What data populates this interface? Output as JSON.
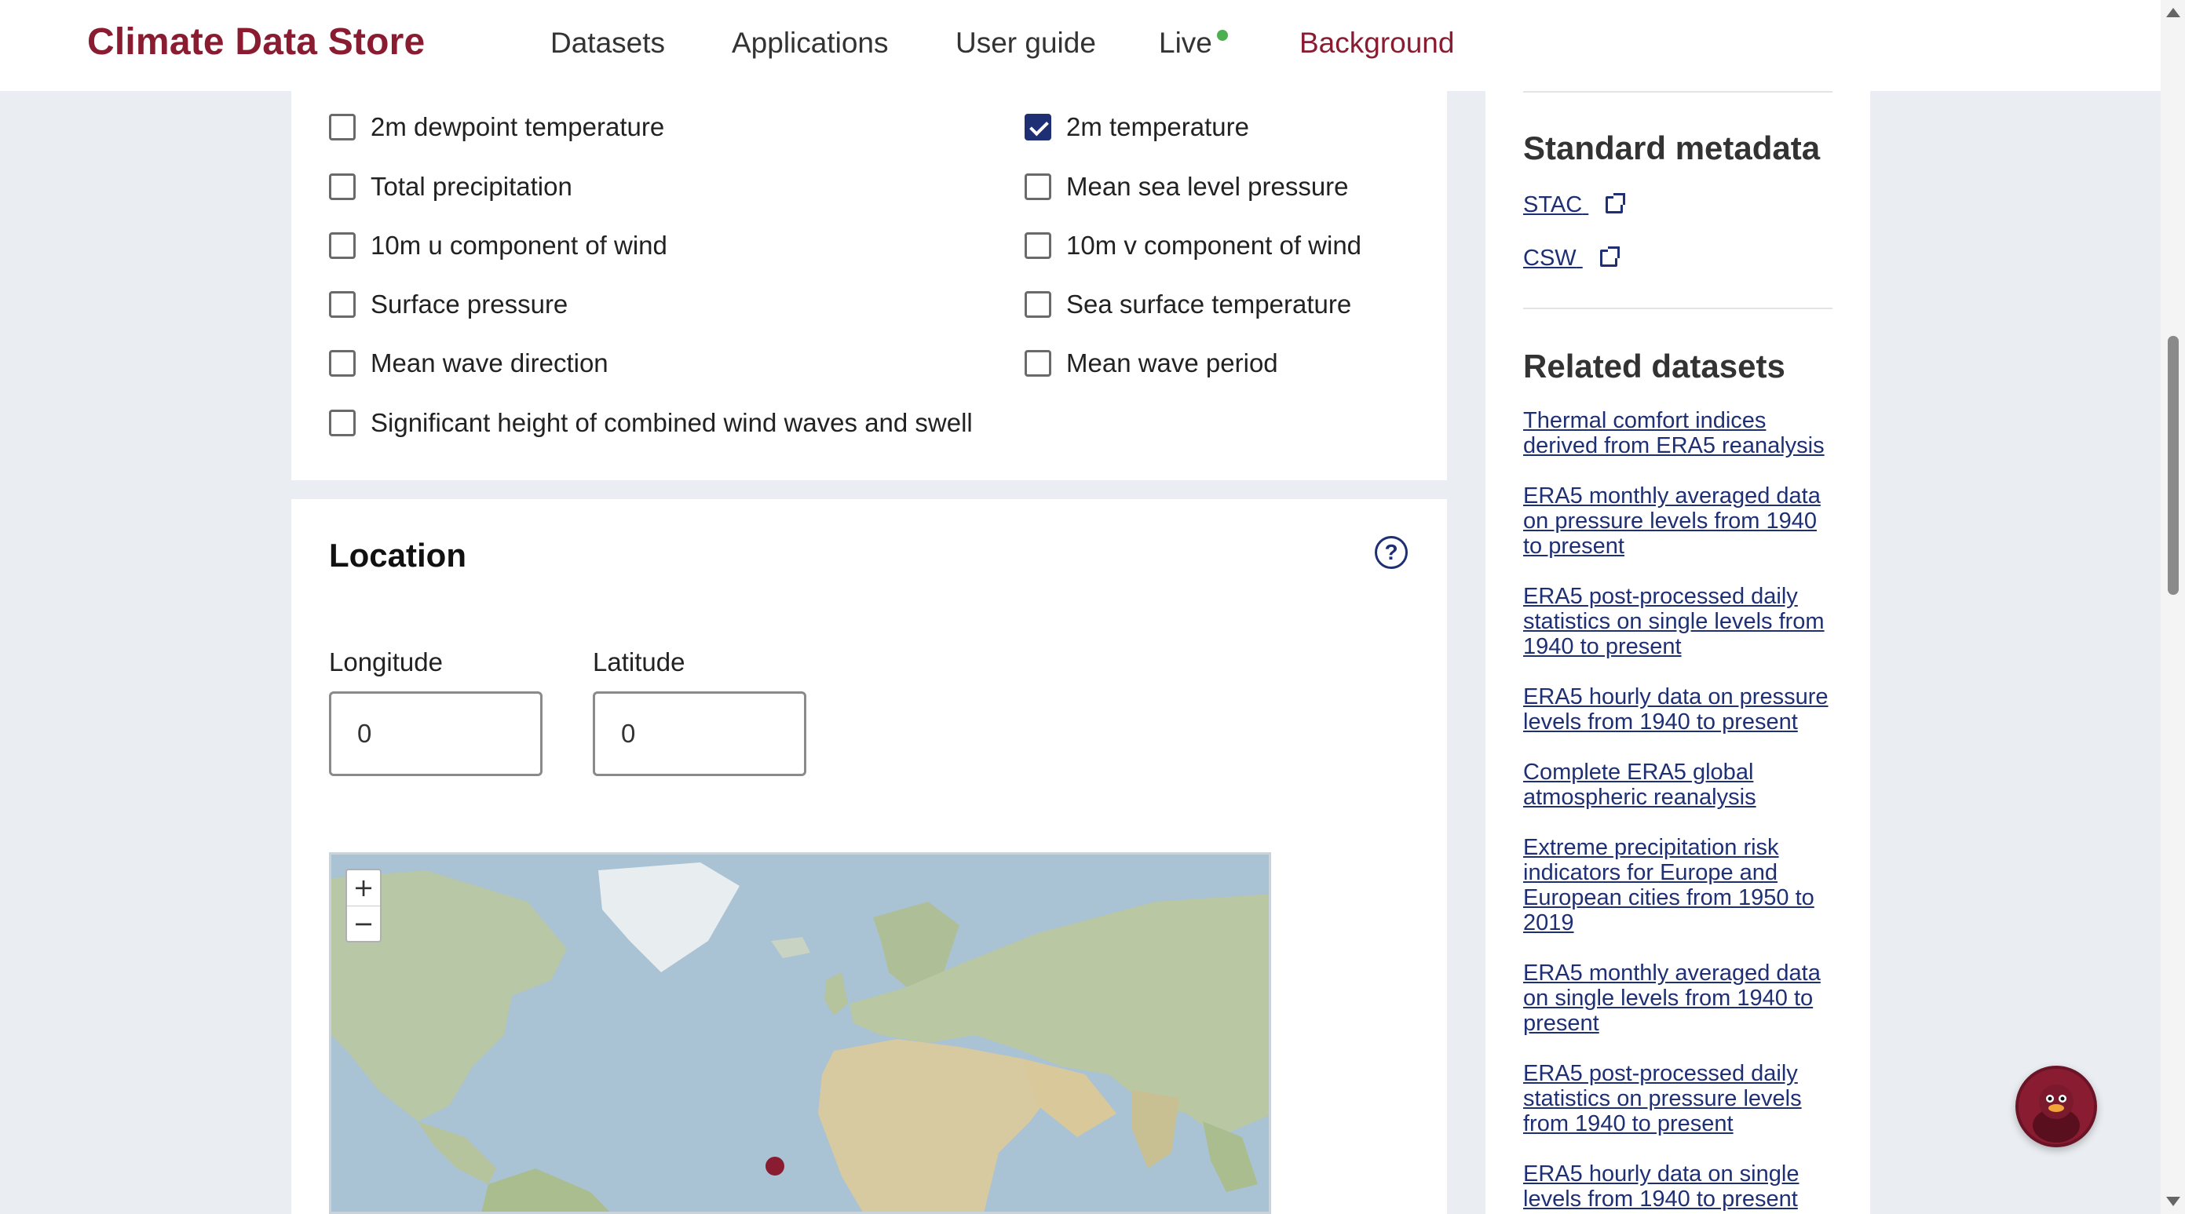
{
  "header": {
    "brand": "Climate Data Store",
    "nav": [
      {
        "label": "Datasets"
      },
      {
        "label": "Applications"
      },
      {
        "label": "User guide"
      },
      {
        "label": "Live"
      },
      {
        "label": "Background"
      }
    ]
  },
  "variables": [
    {
      "label": "2m dewpoint temperature",
      "checked": false
    },
    {
      "label": "2m temperature",
      "checked": true
    },
    {
      "label": "Total precipitation",
      "checked": false
    },
    {
      "label": "Mean sea level pressure",
      "checked": false
    },
    {
      "label": "10m u component of wind",
      "checked": false
    },
    {
      "label": "10m v component of wind",
      "checked": false
    },
    {
      "label": "Surface pressure",
      "checked": false
    },
    {
      "label": "Sea surface temperature",
      "checked": false
    },
    {
      "label": "Mean wave direction",
      "checked": false
    },
    {
      "label": "Mean wave period",
      "checked": false
    },
    {
      "label": "Significant height of combined wind waves and swell",
      "checked": false
    }
  ],
  "location": {
    "title": "Location",
    "help_icon": "?",
    "longitude_label": "Longitude",
    "latitude_label": "Latitude",
    "longitude_value": "0",
    "latitude_value": "0",
    "zoom_in": "+",
    "zoom_out": "−"
  },
  "sidebar": {
    "metadata_heading": "Standard metadata",
    "metadata_links": [
      {
        "label": "STAC"
      },
      {
        "label": "CSW"
      }
    ],
    "related_heading": "Related datasets",
    "related": [
      "Thermal comfort indices derived from ERA5 reanalysis",
      "ERA5 monthly averaged data on pressure levels from 1940 to present",
      "ERA5 post-processed daily statistics on single levels from 1940 to present",
      "ERA5 hourly data on pressure levels from 1940 to present",
      "Complete ERA5 global atmospheric reanalysis",
      "Extreme precipitation risk indicators for Europe and European cities from 1950 to 2019",
      "ERA5 monthly averaged data on single levels from 1940 to present",
      "ERA5 post-processed daily statistics on pressure levels from 1940 to present",
      "ERA5 hourly data on single levels from 1940 to present"
    ]
  },
  "colors": {
    "brand": "#8a1c32",
    "link": "#1e2f73",
    "live_indicator": "#4caf50"
  }
}
